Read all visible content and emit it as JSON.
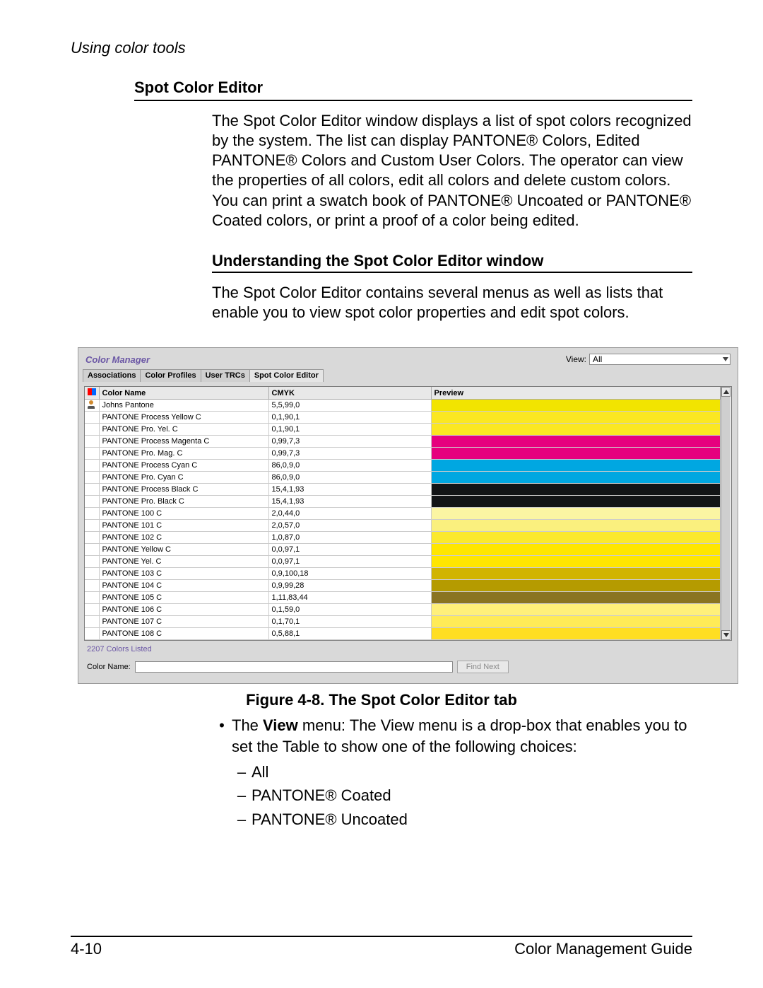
{
  "running_head": "Using color tools",
  "section_heading": "Spot Color Editor",
  "section_body": "The Spot Color Editor window displays a list of spot colors recognized by the system. The list can display PANTONE® Colors, Edited PANTONE® Colors and Custom User Colors. The operator can view the properties of all colors, edit all colors and delete custom colors. You can print a swatch book of PANTONE® Uncoated or PANTONE® Coated colors, or print a proof of a color being edited.",
  "sub_heading": "Understanding the Spot Color Editor window",
  "sub_body": "The Spot Color Editor contains several menus as well as lists that enable you to view spot color properties and edit spot colors.",
  "figure_caption": "Figure 4-8. The Spot Color Editor tab",
  "bullet": {
    "lead_label": "View",
    "lead": "The View menu: The View menu is a drop-box that enables you to set the Table to show one of the following choices:",
    "subitems": [
      "All",
      "PANTONE® Coated",
      "PANTONE® Uncoated"
    ]
  },
  "footer": {
    "page_num": "4-10",
    "book": "Color Management Guide"
  },
  "app": {
    "title": "Color Manager",
    "view_label": "View:",
    "view_value": "All",
    "tabs": [
      "Associations",
      "Color Profiles",
      "User TRCs",
      "Spot Color Editor"
    ],
    "active_tab": 3,
    "columns": {
      "name": "Color Name",
      "cmyk": "CMYK",
      "preview": "Preview"
    },
    "rows": [
      {
        "icon": "user",
        "name": "Johns Pantone",
        "cmyk": "5,5,99,0",
        "color": "#f2e400"
      },
      {
        "icon": "",
        "name": "PANTONE Process Yellow C",
        "cmyk": "0,1,90,1",
        "color": "#fbe722"
      },
      {
        "icon": "",
        "name": "PANTONE Pro. Yel. C",
        "cmyk": "0,1,90,1",
        "color": "#fbe722"
      },
      {
        "icon": "",
        "name": "PANTONE Process Magenta C",
        "cmyk": "0,99,7,3",
        "color": "#e6007e"
      },
      {
        "icon": "",
        "name": "PANTONE Pro. Mag. C",
        "cmyk": "0,99,7,3",
        "color": "#e6007e"
      },
      {
        "icon": "",
        "name": "PANTONE Process Cyan C",
        "cmyk": "86,0,9,0",
        "color": "#00a7e1"
      },
      {
        "icon": "",
        "name": "PANTONE Pro. Cyan C",
        "cmyk": "86,0,9,0",
        "color": "#00a7e1"
      },
      {
        "icon": "",
        "name": "PANTONE Process Black C",
        "cmyk": "15,4,1,93",
        "color": "#121416"
      },
      {
        "icon": "",
        "name": "PANTONE Pro. Black C",
        "cmyk": "15,4,1,93",
        "color": "#121416"
      },
      {
        "icon": "",
        "name": "PANTONE 100 C",
        "cmyk": "2,0,44,0",
        "color": "#fbf5a3"
      },
      {
        "icon": "",
        "name": "PANTONE 101 C",
        "cmyk": "2,0,57,0",
        "color": "#faf07e"
      },
      {
        "icon": "",
        "name": "PANTONE 102 C",
        "cmyk": "1,0,87,0",
        "color": "#fbe92d"
      },
      {
        "icon": "",
        "name": "PANTONE Yellow C",
        "cmyk": "0,0,97,1",
        "color": "#ffe600"
      },
      {
        "icon": "",
        "name": "PANTONE Yel. C",
        "cmyk": "0,0,97,1",
        "color": "#ffe600"
      },
      {
        "icon": "",
        "name": "PANTONE 103 C",
        "cmyk": "0,9,100,18",
        "color": "#d1b400"
      },
      {
        "icon": "",
        "name": "PANTONE 104 C",
        "cmyk": "0,9,99,28",
        "color": "#b59b00"
      },
      {
        "icon": "",
        "name": "PANTONE 105 C",
        "cmyk": "1,11,83,44",
        "color": "#8a7421"
      },
      {
        "icon": "",
        "name": "PANTONE 106 C",
        "cmyk": "0,1,59,0",
        "color": "#fff07a"
      },
      {
        "icon": "",
        "name": "PANTONE 107 C",
        "cmyk": "0,1,70,1",
        "color": "#ffeb57"
      },
      {
        "icon": "",
        "name": "PANTONE 108 C",
        "cmyk": "0,5,88,1",
        "color": "#ffde22"
      }
    ],
    "status": "2207 Colors Listed",
    "find_label": "Color Name:",
    "find_button": "Find Next"
  }
}
